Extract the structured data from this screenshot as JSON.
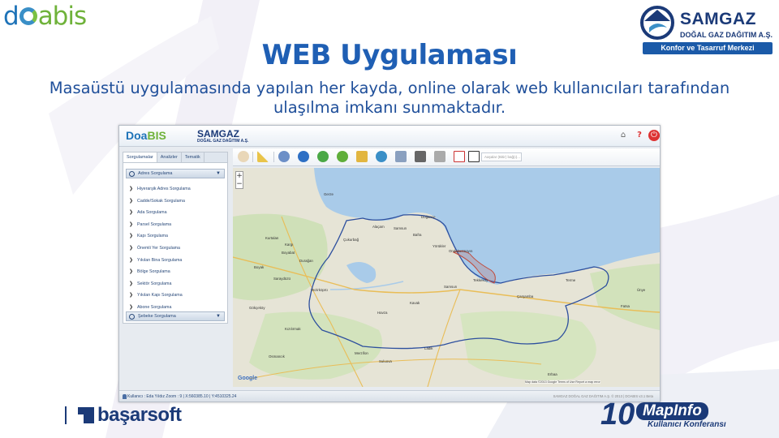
{
  "logos": {
    "doabis_prefix": "d",
    "doabis_suffix": "abis",
    "samgaz_name": "SAMGAZ",
    "samgaz_sub": "DOĞAL GAZ DAĞITIM A.Ş.",
    "samgaz_slogan": "Konfor ve Tasarruf Merkezi",
    "basarsoft": "başarsoft",
    "mapinfo_number": "10",
    "mapinfo_brand": "MapInfo",
    "mapinfo_sub": "Kullanıcı Konferansı"
  },
  "slide": {
    "title": "WEB Uygulaması",
    "subtitle_line1": "Masaüstü uygulamasında yapılan her kayda, online olarak web kullanıcıları tarafından",
    "subtitle_line2": "ulaşılma imkanı sunmaktadır."
  },
  "app": {
    "header_logo_doa": "Doa",
    "header_logo_bis": "BIS",
    "header_logo_samgaz": "SAMGAZ",
    "header_logo_samgaz_sub": "DOĞAL GAZ DAĞITIM A.Ş.",
    "tabs": [
      "Sorgulamalar",
      "Analizler",
      "Tematik"
    ],
    "accordion_top": "Adres Sorgulama",
    "menu_items": [
      "Hiyerarşik Adres Sorgulama",
      "Cadde/Sokak Sorgulama",
      "Ada Sorgulama",
      "Parsel Sorgulama",
      "Kapı Sorgulama",
      "Önemli Yer Sorgulama",
      "Yıkılan Bina Sorgulama",
      "Bölge Sorgulama",
      "Sektör Sorgulama",
      "Yıkılan Kapı Sorgulama",
      "Abone Sorgulama"
    ],
    "accordion_bottom": "Şebeke Sorgulama",
    "toolbar_search_placeholder": "Aaşalar (Bitir) bağ(ı)...",
    "map_labels": {
      "gerze": "Gerze",
      "alacam": "Alaçam",
      "samsun_top": "Samsun",
      "bafra": "Bafra",
      "dogance": "Doğance",
      "yorukler": "Yörükler",
      "ondokuzmayis": "Ondokuzmayıs",
      "cukurbag": "Çukurbağ",
      "kurtalan": "Kurtalan",
      "boyabat": "Boyabat",
      "kargi": "Kargı",
      "duragan": "Durağan",
      "boyak": "Boyak",
      "saraydüzü": "Saraydüzü",
      "vezirkopru": "Vezirköprü",
      "havza": "Havza",
      "kavak": "Kavak",
      "samsun": "Samsun",
      "tekkekoy": "Tekkeköy",
      "carsamba": "Çarşamba",
      "terme": "Terme",
      "unye": "Ünye",
      "fatsa": "Fatsa",
      "merzifon": "Merzifon",
      "suluova": "Suluova",
      "ladik": "Ladik",
      "erbaa": "Erbaa",
      "osmancik": "Osmancık",
      "gokcekoy": "Gökçeköy",
      "kizilirmak": "Kızılırmak"
    },
    "google": "Google",
    "map_attribution": "Map data ©2013 Google  Terms of Use  Report a map error",
    "status_text": "Kullanıcı : Eda Yıldız     Zoom : 9  |  X:560385.10  |  Y:4510325.24",
    "status_right": "SAMGAZ DOĞAL GAZ DAĞITIM A.Ş. © 2013 | DOABIS v3.1 Beta"
  },
  "colors": {
    "title_blue": "#1f5fb4",
    "navy": "#1b3a78",
    "sea": "#a9cbe9",
    "boundary": "#2d4f9e",
    "urban": "#c14a3a"
  },
  "icons": {
    "home": "home-icon",
    "help": "help-icon",
    "power": "power-icon"
  }
}
